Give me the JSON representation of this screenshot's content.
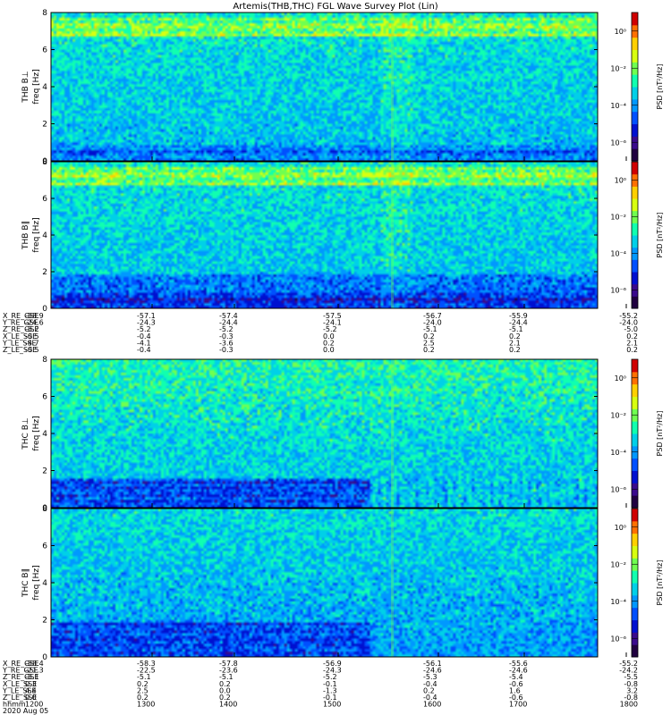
{
  "title": "Artemis(THB,THC) FGL Wave Survey Plot (Lin)",
  "colors": {
    "scale": [
      "#200040",
      "#3a0a8c",
      "#0010d0",
      "#0050ff",
      "#0098ff",
      "#00d0e8",
      "#10ffb0",
      "#70ff50",
      "#d8ff10",
      "#ffd000",
      "#ff7000",
      "#d00000"
    ]
  },
  "chart_data": [
    {
      "type": "heatmap",
      "panel": "THB B⊥",
      "ylabel_probe": "THB B⊥",
      "ylabel_units": "freq [Hz]",
      "yticks": [
        "0",
        "2",
        "4",
        "6",
        "8"
      ],
      "ylim": [
        0,
        8
      ],
      "cbar_label": "PSD [nT²/Hz]",
      "cbar_ticks": [
        "10⁰",
        "10⁻²",
        "10⁻⁴",
        "10⁻⁶"
      ],
      "cbar_exponents": [
        0,
        -2,
        -4,
        -6
      ],
      "cbar_range": [
        -7,
        1
      ],
      "style": "perp"
    },
    {
      "type": "heatmap",
      "panel": "THB B∥",
      "ylabel_probe": "THB B∥",
      "ylabel_units": "freq [Hz]",
      "yticks": [
        "0",
        "2",
        "4",
        "6",
        "8"
      ],
      "ylim": [
        0,
        8
      ],
      "cbar_label": "PSD [nT²/Hz]",
      "cbar_ticks": [
        "10⁰",
        "10⁻²",
        "10⁻⁴",
        "10⁻⁶"
      ],
      "cbar_exponents": [
        0,
        -2,
        -4,
        -6
      ],
      "cbar_range": [
        -7,
        1
      ],
      "style": "par"
    },
    {
      "type": "heatmap",
      "panel": "THC B⊥",
      "ylabel_probe": "THC B⊥",
      "ylabel_units": "freq [Hz]",
      "yticks": [
        "0",
        "2",
        "4",
        "6",
        "8"
      ],
      "ylim": [
        0,
        8
      ],
      "cbar_label": "PSD [nT²/Hz]",
      "cbar_ticks": [
        "10⁰",
        "10⁻²",
        "10⁻⁴",
        "10⁻⁶"
      ],
      "cbar_exponents": [
        0,
        -2,
        -4,
        -6
      ],
      "cbar_range": [
        -7,
        1
      ],
      "style": "thc_perp"
    },
    {
      "type": "heatmap",
      "panel": "THC B∥",
      "ylabel_probe": "THC B∥",
      "ylabel_units": "freq [Hz]",
      "yticks": [
        "0",
        "2",
        "4",
        "6",
        "8"
      ],
      "ylim": [
        0,
        8
      ],
      "cbar_label": "PSD [nT²/Hz]",
      "cbar_ticks": [
        "10⁰",
        "10⁻²",
        "10⁻⁴",
        "10⁻⁶"
      ],
      "cbar_exponents": [
        0,
        -2,
        -4,
        -6
      ],
      "cbar_range": [
        -7,
        1
      ],
      "style": "thc_par"
    }
  ],
  "ephem_b": {
    "labels": [
      "X_RE_GSE",
      "Y_RE_GSE",
      "Z_RE_GSE",
      "X_LE_SSE",
      "Y_LE_SSE",
      "Z_LE_SSE"
    ],
    "rows": [
      [
        "-58.9",
        "-57.1",
        "-57.4",
        "-57.5",
        "-56.7",
        "-55.9",
        "-55.2"
      ],
      [
        "-24.6",
        "-24.3",
        "-24.4",
        "-24.1",
        "-24.0",
        "-24.4",
        "-24.0"
      ],
      [
        "-5.2",
        "-5.2",
        "-5.2",
        "-5.2",
        "-5.1",
        "-5.1",
        "-5.0"
      ],
      [
        "-0.5",
        "-0.4",
        "-0.3",
        "0.0",
        "0.2",
        "0.2",
        "0.2"
      ],
      [
        "-4.7",
        "-4.1",
        "-3.6",
        "0.2",
        "2.5",
        "2.1",
        "2.1"
      ],
      [
        "-0.5",
        "-0.4",
        "-0.3",
        "0.0",
        "0.2",
        "0.2",
        "0.2"
      ]
    ]
  },
  "ephem_c": {
    "labels": [
      "X_RE_GSE",
      "Y_RE_GSE",
      "Z_RE_GSE",
      "X_LE_SSE",
      "Y_LE_SSE",
      "Z_LE_SSE",
      "hhmm",
      "2020 Aug 05"
    ],
    "rows": [
      [
        "-58.4",
        "-58.3",
        "-57.8",
        "-56.9",
        "-56.1",
        "-55.6",
        "-55.2"
      ],
      [
        "-21.3",
        "-22.5",
        "-23.6",
        "-24.3",
        "-24.6",
        "-24.6",
        "-24.2"
      ],
      [
        "-5.1",
        "-5.1",
        "-5.1",
        "-5.2",
        "-5.3",
        "-5.4",
        "-5.5"
      ],
      [
        "0.3",
        "0.2",
        "0.2",
        "-0.1",
        "-0.4",
        "-0.6",
        "-0.8"
      ],
      [
        "4.4",
        "2.5",
        "0.0",
        "-1.3",
        "0.2",
        "1.6",
        "3.2"
      ],
      [
        "0.0",
        "0.2",
        "0.2",
        "-0.1",
        "-0.4",
        "-0.6",
        "-0.8"
      ],
      [
        "1200",
        "1300",
        "1400",
        "1500",
        "1600",
        "1700",
        "1800"
      ]
    ]
  }
}
